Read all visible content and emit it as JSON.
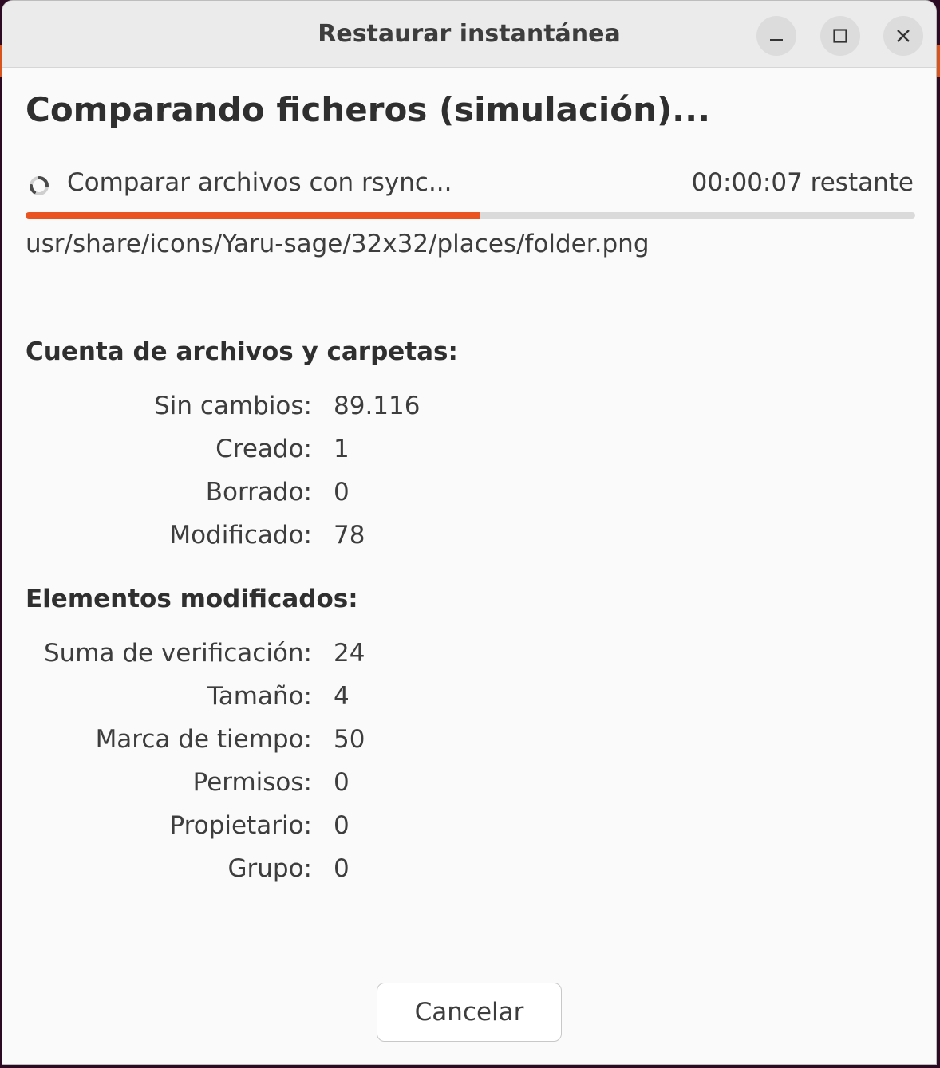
{
  "window": {
    "title": "Restaurar instantánea"
  },
  "main": {
    "heading": "Comparando ficheros (simulación)...",
    "status_text": "Comparar archivos con rsync...",
    "time_remaining": "00:00:07 restante",
    "progress_fraction": 0.51,
    "current_file": "usr/share/icons/Yaru-sage/32x32/places/folder.png"
  },
  "counts": {
    "title": "Cuenta de archivos y carpetas:",
    "rows": [
      {
        "label": "Sin cambios:",
        "value": "89.116"
      },
      {
        "label": "Creado:",
        "value": "1"
      },
      {
        "label": "Borrado:",
        "value": "0"
      },
      {
        "label": "Modificado:",
        "value": "78"
      }
    ]
  },
  "modified": {
    "title": "Elementos modificados:",
    "rows": [
      {
        "label": "Suma de verificación:",
        "value": "24"
      },
      {
        "label": "Tamaño:",
        "value": "4"
      },
      {
        "label": "Marca de tiempo:",
        "value": "50"
      },
      {
        "label": "Permisos:",
        "value": "0"
      },
      {
        "label": "Propietario:",
        "value": "0"
      },
      {
        "label": "Grupo:",
        "value": "0"
      }
    ]
  },
  "buttons": {
    "cancel_label": "Cancelar"
  },
  "colors": {
    "accent": "#e95420",
    "desktop_accent": "#d9541d"
  },
  "icons": {
    "minimize": "minimize-icon",
    "maximize": "maximize-icon",
    "close": "close-icon",
    "spinner": "spinner-icon"
  }
}
